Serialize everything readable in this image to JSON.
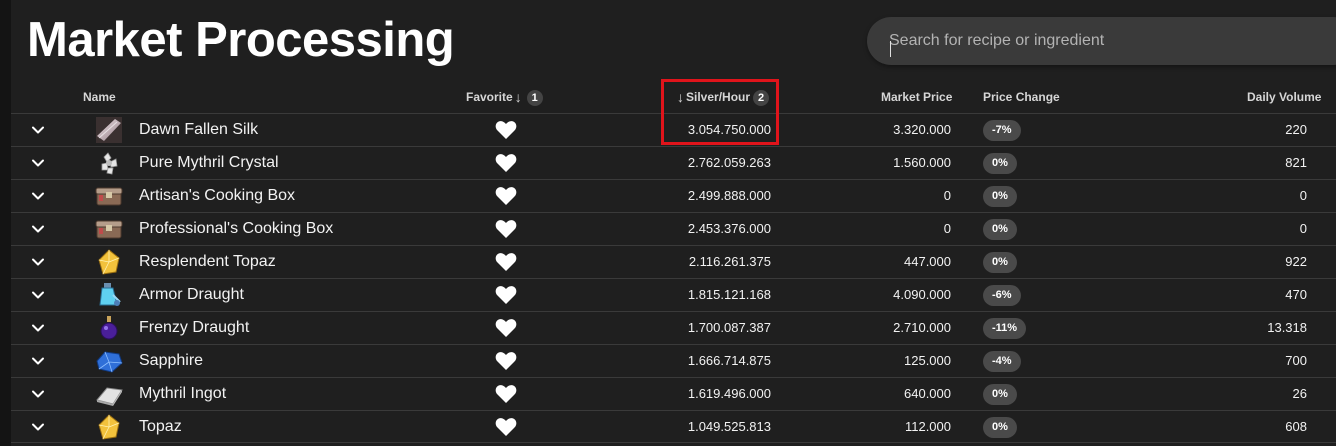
{
  "page": {
    "title": "Market Processing"
  },
  "search": {
    "placeholder": "Search for recipe or ingredient",
    "value": ""
  },
  "table": {
    "columns": {
      "name": "Name",
      "favorite": "Favorite",
      "favorite_sort_order": "1",
      "silver_hour": "Silver/Hour",
      "silver_hour_sort_order": "2",
      "market_price": "Market Price",
      "price_change": "Price Change",
      "daily_volume": "Daily Volume"
    },
    "rows": [
      {
        "name": "Dawn Fallen Silk",
        "icon": "silk-icon",
        "silver_hour": "3.054.750.000",
        "market_price": "3.320.000",
        "price_change": "-7%",
        "daily_volume": "220",
        "favorite": true
      },
      {
        "name": "Pure Mythril Crystal",
        "icon": "crystal-icon",
        "silver_hour": "2.762.059.263",
        "market_price": "1.560.000",
        "price_change": "0%",
        "daily_volume": "821",
        "favorite": true
      },
      {
        "name": "Artisan's Cooking Box",
        "icon": "cooking-box-icon",
        "silver_hour": "2.499.888.000",
        "market_price": "0",
        "price_change": "0%",
        "daily_volume": "0",
        "favorite": true
      },
      {
        "name": "Professional's Cooking Box",
        "icon": "cooking-box-icon",
        "silver_hour": "2.453.376.000",
        "market_price": "0",
        "price_change": "0%",
        "daily_volume": "0",
        "favorite": true
      },
      {
        "name": "Resplendent Topaz",
        "icon": "topaz-icon",
        "silver_hour": "2.116.261.375",
        "market_price": "447.000",
        "price_change": "0%",
        "daily_volume": "922",
        "favorite": true
      },
      {
        "name": "Armor Draught",
        "icon": "draught-bottle-icon",
        "silver_hour": "1.815.121.168",
        "market_price": "4.090.000",
        "price_change": "-6%",
        "daily_volume": "470",
        "favorite": true
      },
      {
        "name": "Frenzy Draught",
        "icon": "potion-flask-icon",
        "silver_hour": "1.700.087.387",
        "market_price": "2.710.000",
        "price_change": "-11%",
        "daily_volume": "13.318",
        "favorite": true
      },
      {
        "name": "Sapphire",
        "icon": "sapphire-icon",
        "silver_hour": "1.666.714.875",
        "market_price": "125.000",
        "price_change": "-4%",
        "daily_volume": "700",
        "favorite": true
      },
      {
        "name": "Mythril Ingot",
        "icon": "ingot-icon",
        "silver_hour": "1.619.496.000",
        "market_price": "640.000",
        "price_change": "0%",
        "daily_volume": "26",
        "favorite": true
      },
      {
        "name": "Topaz",
        "icon": "topaz-icon",
        "silver_hour": "1.049.525.813",
        "market_price": "112.000",
        "price_change": "0%",
        "daily_volume": "608",
        "favorite": true
      }
    ]
  },
  "colors": {
    "background": "#1f1f1f",
    "highlight": "#e0141b",
    "pill": "#4a4a4a",
    "search": "#3a3a3a"
  }
}
